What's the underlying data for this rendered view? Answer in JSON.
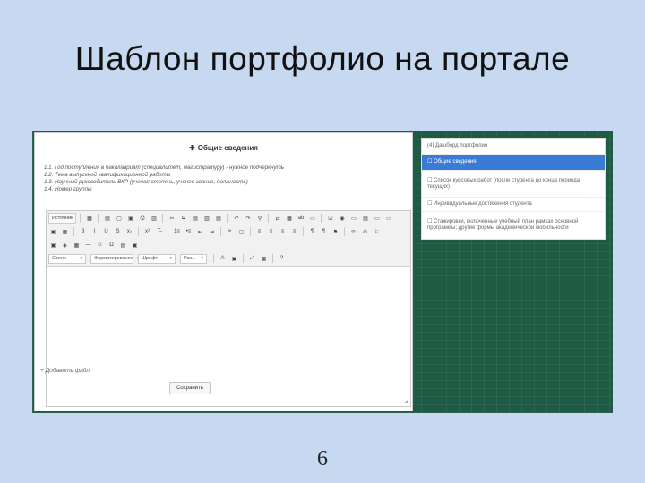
{
  "slide": {
    "title": "Шаблон портфолио на портале",
    "page_number": "6"
  },
  "form": {
    "header": "Общие сведения",
    "header_icon": "plus-icon",
    "instructions": [
      "1.1. Год поступления в бакалавриат (специалитет, магистратуру) - нужное подчеркнуть",
      "1.2. Тема выпускной квалификационной работы",
      "1.3. Научный руководитель ВКР (ученая степень, ученое звание, должность)",
      "1.4. Номер группы"
    ],
    "add_file_label": "Добавить файл",
    "save_label": "Сохранить"
  },
  "editor": {
    "source_label": "Источник",
    "selects": {
      "style": "Стили",
      "format": "Форматирование",
      "font": "Шрифт",
      "size": "Раз..."
    },
    "resize_handle": "◢",
    "toolbar_icons": {
      "row1": [
        "source-icon",
        "save-icon",
        "new-page-icon",
        "preview-icon",
        "print-icon",
        "templates-icon",
        "cut-icon",
        "copy-icon",
        "paste-icon",
        "paste-text-icon",
        "paste-word-icon",
        "undo-icon",
        "redo-icon",
        "find-icon",
        "replace-icon",
        "select-all-icon",
        "spellcheck-icon",
        "form-icon",
        "checkbox-icon",
        "radio-icon",
        "textfield-icon",
        "textarea-icon",
        "select-field-icon",
        "button-icon"
      ],
      "row2": [
        "image-button-icon",
        "hidden-field-icon",
        "bold-icon",
        "italic-icon",
        "underline-icon",
        "strike-icon",
        "subscript-icon",
        "superscript-icon",
        "remove-format-icon",
        "numbered-list-icon",
        "bulleted-list-icon",
        "outdent-icon",
        "indent-icon",
        "blockquote-icon",
        "div-icon",
        "align-left-icon",
        "align-center-icon",
        "align-right-icon",
        "justify-icon",
        "ltr-icon",
        "rtl-icon",
        "language-icon",
        "link-icon",
        "unlink-icon",
        "anchor-icon"
      ],
      "row3": [
        "image-icon",
        "flash-icon",
        "table-icon",
        "hr-icon",
        "smiley-icon",
        "special-char-icon",
        "page-break-icon",
        "iframe-icon"
      ],
      "row4": [
        "text-color-icon",
        "bg-color-icon",
        "maximize-icon",
        "show-blocks-icon",
        "help-icon"
      ]
    },
    "toolbar_glyphs": {
      "row1": [
        "▦",
        "▤",
        "▢",
        "▣",
        "⎙",
        "▥",
        "✂",
        "⧉",
        "▤",
        "▥",
        "▤",
        "↶",
        "↷",
        "⚲",
        "⇄",
        "▦",
        "ab",
        "▭",
        "☑",
        "◉",
        "▭",
        "▤",
        "▭",
        "▭"
      ],
      "row2": [
        "▣",
        "▦",
        "B",
        "I",
        "U",
        "S",
        "x₂",
        "x²",
        "T̶",
        "1≡",
        "•≡",
        "⇤",
        "⇥",
        "❝",
        "▢",
        "≡",
        "≡",
        "≡",
        "≡",
        "¶",
        "¶",
        "⚑",
        "∞",
        "⊘",
        "⚐"
      ],
      "row3": [
        "▣",
        "◈",
        "▦",
        "―",
        "☺",
        "Ω",
        "▤",
        "▣"
      ],
      "row4": [
        "A",
        "▣",
        "⤢",
        "▦",
        "?"
      ]
    }
  },
  "sidebar": {
    "items": [
      {
        "label": "(4) Дашборд портфолио",
        "active": false
      },
      {
        "label": "☐ Общие сведения",
        "active": true
      },
      {
        "label": "☐ Список курсовых работ (после студента до конца периода текущих)",
        "active": false
      },
      {
        "label": "☐ Индивидуальные достижения студента",
        "active": false
      },
      {
        "label": "☐ Стажировки, включенные учебный план рамках основной программы; другие формы академической мобильности",
        "active": false
      }
    ]
  },
  "colors": {
    "slide_background": "#c6d9f1",
    "board_background": "#1f5a45",
    "sidebar_active": "#3a7bd5"
  }
}
